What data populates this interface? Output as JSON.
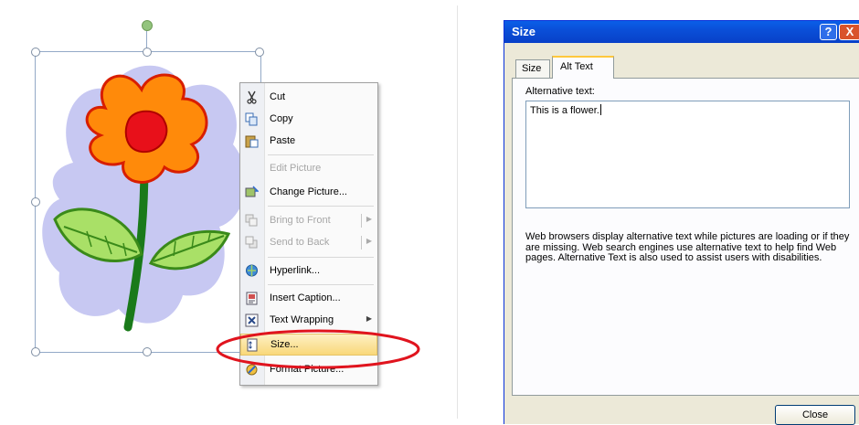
{
  "context_menu": {
    "items": [
      {
        "label": "Cut",
        "icon": "scissors-icon",
        "enabled": true
      },
      {
        "label": "Copy",
        "icon": "copy-icon",
        "enabled": true
      },
      {
        "label": "Paste",
        "icon": "paste-icon",
        "enabled": true
      },
      {
        "label": "Edit Picture",
        "icon": "",
        "enabled": false
      },
      {
        "label": "Change Picture...",
        "icon": "change-picture-icon",
        "enabled": true
      },
      {
        "label": "Bring to Front",
        "icon": "bring-to-front-icon",
        "enabled": false
      },
      {
        "label": "Send to Back",
        "icon": "send-to-back-icon",
        "enabled": false
      },
      {
        "label": "Hyperlink...",
        "icon": "hyperlink-icon",
        "enabled": true
      },
      {
        "label": "Insert Caption...",
        "icon": "insert-caption-icon",
        "enabled": true
      },
      {
        "label": "Text Wrapping",
        "icon": "text-wrapping-icon",
        "enabled": true
      },
      {
        "label": "Size...",
        "icon": "size-icon",
        "enabled": true,
        "highlighted": true
      },
      {
        "label": "Format Picture...",
        "icon": "format-picture-icon",
        "enabled": true
      }
    ]
  },
  "dialog": {
    "title": "Size",
    "help_button": "?",
    "close_x": "X",
    "tabs": [
      {
        "label": "Size",
        "active": false
      },
      {
        "label": "Alt Text",
        "active": true
      }
    ],
    "alt_text_label": "Alternative text:",
    "alt_text_value": "This is a flower.",
    "help_text": "Web browsers display alternative text while pictures are loading or if they are missing.  Web search engines use alternative text to help find Web pages.  Alternative Text is also used to assist users with disabilities.",
    "close_button": "Close"
  },
  "colors": {
    "highlight_ellipse": "#e0141e",
    "titlebar": "#0a4fd8",
    "menu_highlight": "#f9d87a"
  }
}
